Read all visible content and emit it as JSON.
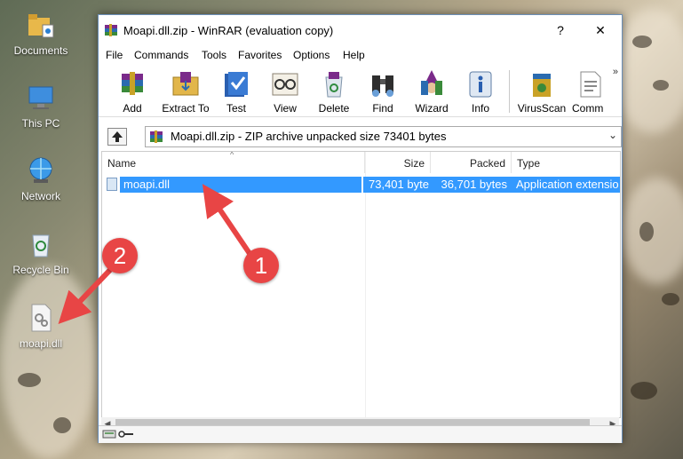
{
  "desktop": {
    "icons": [
      {
        "label": "Documents",
        "icon": "folder-documents-icon"
      },
      {
        "label": "This PC",
        "icon": "computer-icon"
      },
      {
        "label": "Network",
        "icon": "network-globe-icon"
      },
      {
        "label": "Recycle Bin",
        "icon": "recycle-bin-icon"
      },
      {
        "label": "moapi.dll",
        "icon": "dll-file-icon"
      }
    ]
  },
  "window": {
    "title": "Moapi.dll.zip - WinRAR (evaluation copy)",
    "help_button": "?",
    "close_button": "✕"
  },
  "menu": [
    "File",
    "Commands",
    "Tools",
    "Favorites",
    "Options",
    "Help"
  ],
  "toolbar": {
    "buttons": [
      {
        "label": "Add",
        "icon": "add-archive-icon"
      },
      {
        "label": "Extract To",
        "icon": "extract-folder-icon"
      },
      {
        "label": "Test",
        "icon": "test-check-icon"
      },
      {
        "label": "View",
        "icon": "view-glasses-icon"
      },
      {
        "label": "Delete",
        "icon": "delete-recycle-icon"
      },
      {
        "label": "Find",
        "icon": "find-binoculars-icon"
      },
      {
        "label": "Wizard",
        "icon": "wizard-icon"
      },
      {
        "label": "Info",
        "icon": "info-icon"
      },
      {
        "label": "VirusScan",
        "icon": "virus-scan-icon"
      },
      {
        "label": "Comm",
        "icon": "comment-icon"
      }
    ],
    "more": "»"
  },
  "address": {
    "text": "Moapi.dll.zip - ZIP archive unpacked size 73401 bytes",
    "dropdown": "⌄"
  },
  "list": {
    "columns": [
      "Name",
      "Size",
      "Packed",
      "Type"
    ],
    "rows": [
      {
        "name": "moapi.dll",
        "size": "73,401 byte",
        "packed": "36,701 bytes",
        "type": "Application extensio",
        "selected": true
      }
    ]
  },
  "annotations": {
    "badge1": "1",
    "badge2": "2",
    "color": "#e84545"
  },
  "colors": {
    "selection": "#3399ff"
  }
}
